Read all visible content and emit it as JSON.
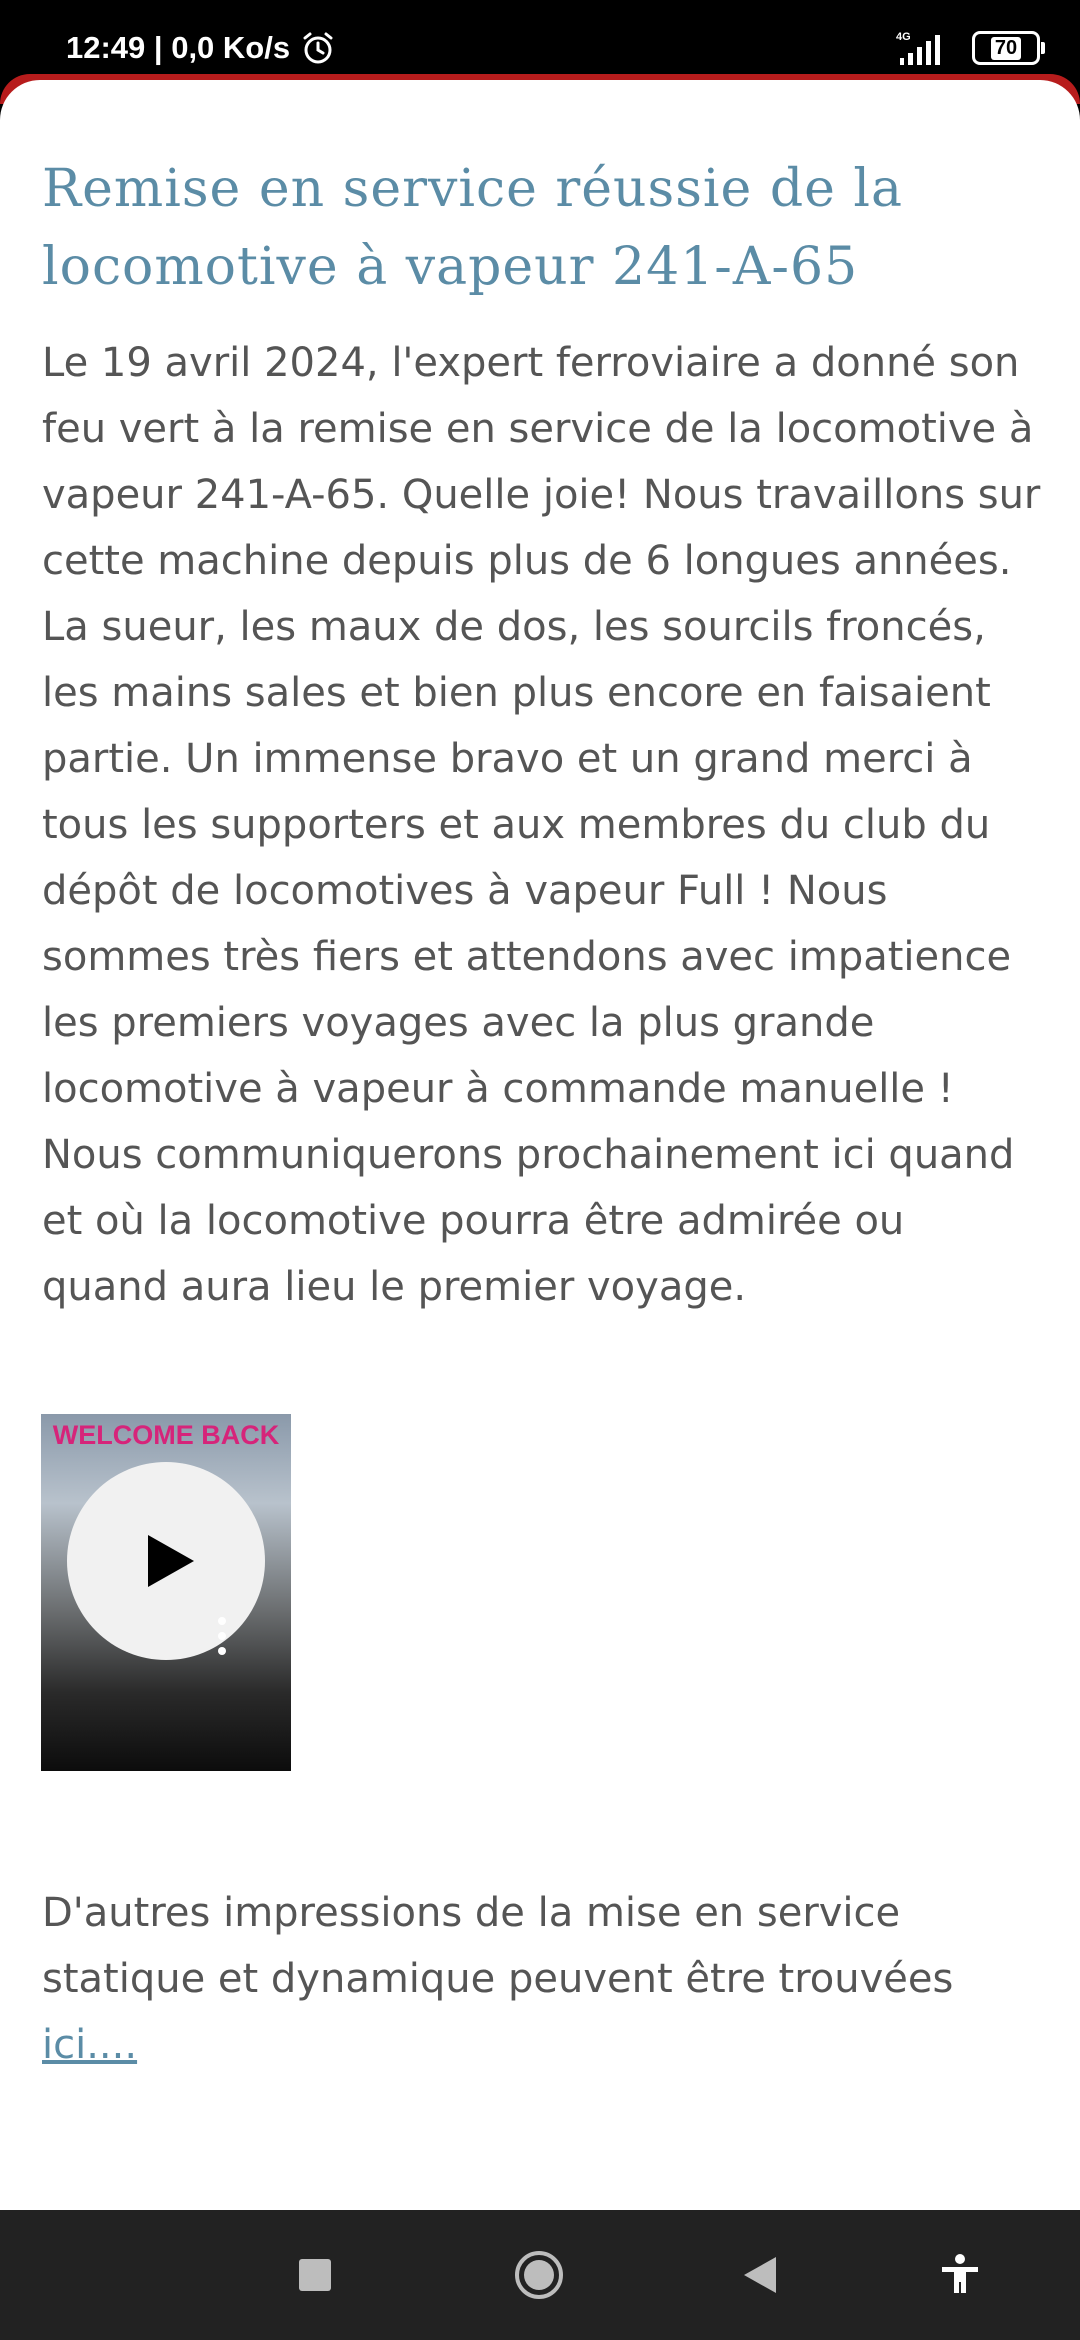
{
  "status_bar": {
    "time": "12:49",
    "net_speed": "0,0 Ko/s",
    "network_type": "4G",
    "battery": "70",
    "battery_level": 0.7,
    "icons": [
      "alarm-icon",
      "signal-icon",
      "battery-icon"
    ]
  },
  "article": {
    "title": "Remise en service réussie de la locomotive à vapeur 241-A-65",
    "body": "Le 19 avril 2024, l'expert ferroviaire a donné son feu vert à la remise en service de la locomotive à vapeur 241-A-65. Quelle joie! Nous travaillons sur cette machine depuis plus de 6 longues années. La sueur, les maux de dos, les sourcils froncés, les mains sales et bien plus encore en faisaient partie. Un immense bravo et un grand merci à tous les supporters et aux membres du club du dépôt de locomotives à vapeur Full ! Nous sommes très fiers et attendons avec impatience les premiers voyages avec la plus grande locomotive à vapeur à commande manuelle ! Nous communiquerons prochainement ici quand et où la locomotive pourra être admirée ou quand aura lieu le premier voyage.",
    "video": {
      "caption": "WELCOME BACK",
      "progress": 0
    },
    "more_text": "D'autres impressions de la mise en service statique et dynamique peuvent être trouvées",
    "more_link": "ici...."
  },
  "colors": {
    "title": "#5b8ca6",
    "text": "#555555",
    "link": "#5b8ca6",
    "accent": "#b71c1c",
    "nav_bar": "#222222"
  },
  "nav_bar": {
    "icons": [
      "recents-icon",
      "home-icon",
      "back-icon",
      "accessibility-icon"
    ]
  }
}
